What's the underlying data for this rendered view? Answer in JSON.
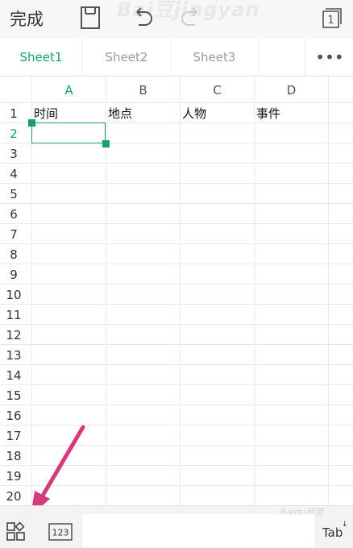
{
  "toolbar": {
    "done_label": "完成",
    "save_icon": "save-icon",
    "undo_icon": "undo-icon",
    "redo_icon": "redo-icon",
    "window_count": "1",
    "watermark": "Bai豆jingyan"
  },
  "sheets": {
    "tabs": [
      "Sheet1",
      "Sheet2",
      "Sheet3"
    ],
    "active": "Sheet1",
    "more_label": "•••"
  },
  "grid": {
    "columns": [
      "A",
      "B",
      "C",
      "D"
    ],
    "rows": [
      "1",
      "2",
      "3",
      "4",
      "5",
      "6",
      "7",
      "8",
      "9",
      "10",
      "11",
      "12",
      "13",
      "14",
      "15",
      "16",
      "17",
      "18",
      "19",
      "20"
    ],
    "active_row": "2",
    "active_column": "A",
    "row1": [
      "时间",
      "地点",
      "人物",
      "事件"
    ]
  },
  "bottom": {
    "apps_icon": "apps-grid-icon",
    "keyboard_label": "123",
    "tab_label": "Tab",
    "tab_arrow": "↓",
    "watermark": "Baidu经验"
  },
  "colors": {
    "accent": "#1a9e6e",
    "annotation_arrow": "#d63a7a"
  }
}
